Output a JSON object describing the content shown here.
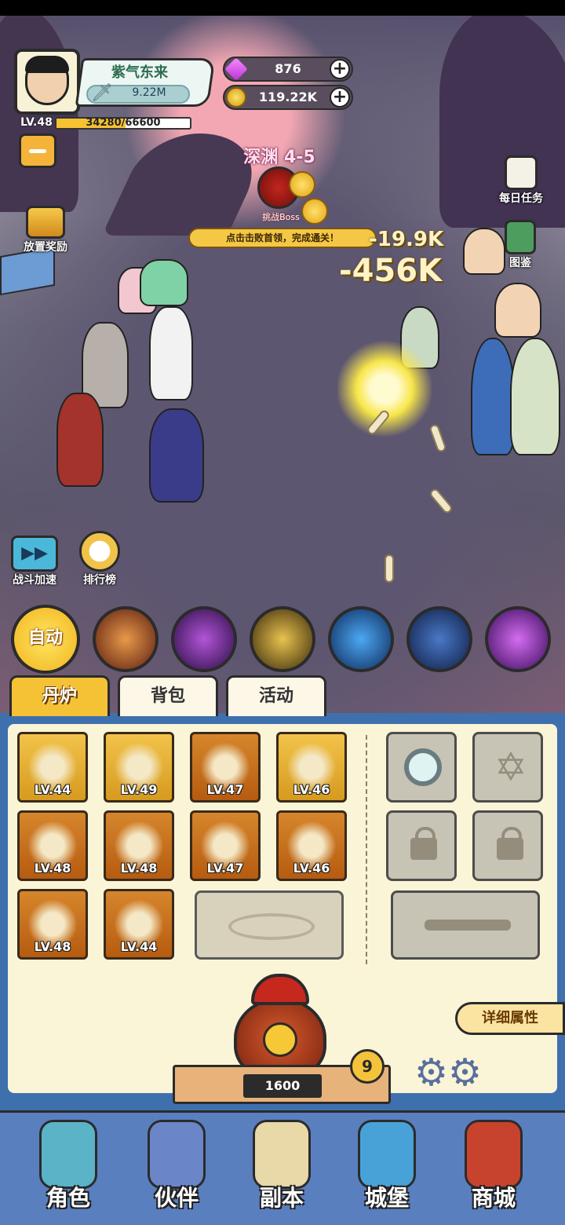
{
  "player": {
    "name": "紫气东来",
    "power": "9.22M",
    "level_label": "LV.48",
    "exp_text": "34280/66600",
    "exp_current": 34280,
    "exp_max": 66600,
    "avatar_icon": "player-avatar"
  },
  "currency": {
    "gems": "876",
    "coins": "119.22K"
  },
  "side_buttons": {
    "idle_reward": "放置奖励",
    "daily_tasks": "每日任务",
    "codex": "图鉴",
    "battle_speed": "战斗加速",
    "leaderboard": "排行榜"
  },
  "stage": {
    "title": "深渊 4-5",
    "boss_label": "挑战Boss",
    "hint": "点击击败首领，完成通关！"
  },
  "damage_numbers": [
    "-19.9K",
    "-456K"
  ],
  "skills": {
    "auto_label": "自动",
    "icons": [
      "whirlwind-skill-icon",
      "vortex-skill-icon",
      "swords-skill-icon",
      "fireball-skill-icon",
      "lightning-skill-icon",
      "void-skill-icon"
    ]
  },
  "tabs": [
    "丹炉",
    "背包",
    "活动"
  ],
  "equipment": [
    {
      "icon": "sword-icon",
      "level": "LV.44"
    },
    {
      "icon": "helmet-icon",
      "level": "LV.49"
    },
    {
      "icon": "armor-icon",
      "level": "LV.47"
    },
    {
      "icon": "crane-orb-icon",
      "level": "LV.46"
    },
    {
      "icon": "shoulder-armor-icon",
      "level": "LV.48"
    },
    {
      "icon": "shield-icon",
      "level": "LV.48"
    },
    {
      "icon": "ring-icon",
      "level": "LV.47"
    },
    {
      "icon": "jade-orb-icon",
      "level": "LV.46"
    },
    {
      "icon": "amulet-icon",
      "level": "LV.48"
    },
    {
      "icon": "boots-icon",
      "level": "LV.44"
    }
  ],
  "furnace": {
    "cost": "1600",
    "count": "9",
    "detail_label": "详细属性"
  },
  "nav": [
    "角色",
    "伙伴",
    "副本",
    "城堡",
    "商城"
  ],
  "colors": {
    "panel_blue": "#3f70ae",
    "panel_cream": "#fbf5d7",
    "accent_gold": "#f4c33a",
    "nav_blue": "#5a7fbf"
  }
}
